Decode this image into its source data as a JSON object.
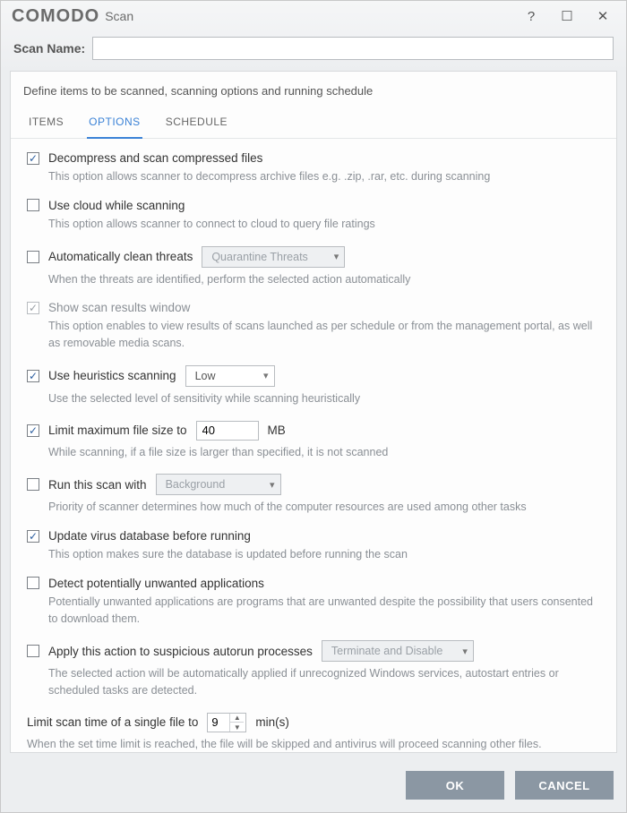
{
  "titlebar": {
    "brand": "COMODO",
    "sub": "Scan"
  },
  "scanName": {
    "label": "Scan Name:",
    "value": ""
  },
  "description": "Define items to be scanned, scanning options and running schedule",
  "tabs": {
    "items": "ITEMS",
    "options": "OPTIONS",
    "schedule": "SCHEDULE",
    "active": "OPTIONS"
  },
  "opts": {
    "decompress": {
      "checked": true,
      "label": "Decompress and scan compressed files",
      "desc": "This option allows scanner to decompress archive files e.g. .zip, .rar, etc. during scanning"
    },
    "cloud": {
      "checked": false,
      "label": "Use cloud while scanning",
      "desc": "This option allows scanner to connect to cloud to query file ratings"
    },
    "autoclean": {
      "checked": false,
      "label": "Automatically clean threats",
      "select": "Quarantine Threats",
      "desc": "When the threats are identified, perform the selected action automatically"
    },
    "results": {
      "checked": true,
      "disabled": true,
      "label": "Show scan results window",
      "desc": "This option enables to view results of scans launched as per schedule or from the management portal, as well as removable media scans."
    },
    "heuristics": {
      "checked": true,
      "label": "Use heuristics scanning",
      "select": "Low",
      "desc": "Use the selected level of sensitivity while scanning heuristically"
    },
    "maxsize": {
      "checked": true,
      "label": "Limit maximum file size to",
      "value": "40",
      "unit": "MB",
      "desc": "While scanning, if a file size is larger than specified, it is not scanned"
    },
    "priority": {
      "checked": false,
      "label": "Run this scan with",
      "select": "Background",
      "desc": "Priority of scanner determines how much of the computer resources are used among other tasks"
    },
    "update": {
      "checked": true,
      "label": "Update virus database before running",
      "desc": "This option makes sure the database is updated before running the scan"
    },
    "pua": {
      "checked": false,
      "label": "Detect potentially unwanted applications",
      "desc": "Potentially unwanted applications are programs that are unwanted despite the possibility that users consented to download them."
    },
    "autorun": {
      "checked": false,
      "label": "Apply this action to suspicious autorun processes",
      "select": "Terminate and Disable",
      "desc": "The selected action will be automatically applied if unrecognized Windows services, autostart entries or scheduled tasks are detected."
    },
    "timelimit": {
      "label": "Limit scan time of a single file to",
      "value": "9",
      "unit": "min(s)",
      "desc": "When the set time limit is reached, the file will be skipped and antivirus will proceed scanning other files."
    }
  },
  "footer": {
    "ok": "OK",
    "cancel": "CANCEL"
  }
}
